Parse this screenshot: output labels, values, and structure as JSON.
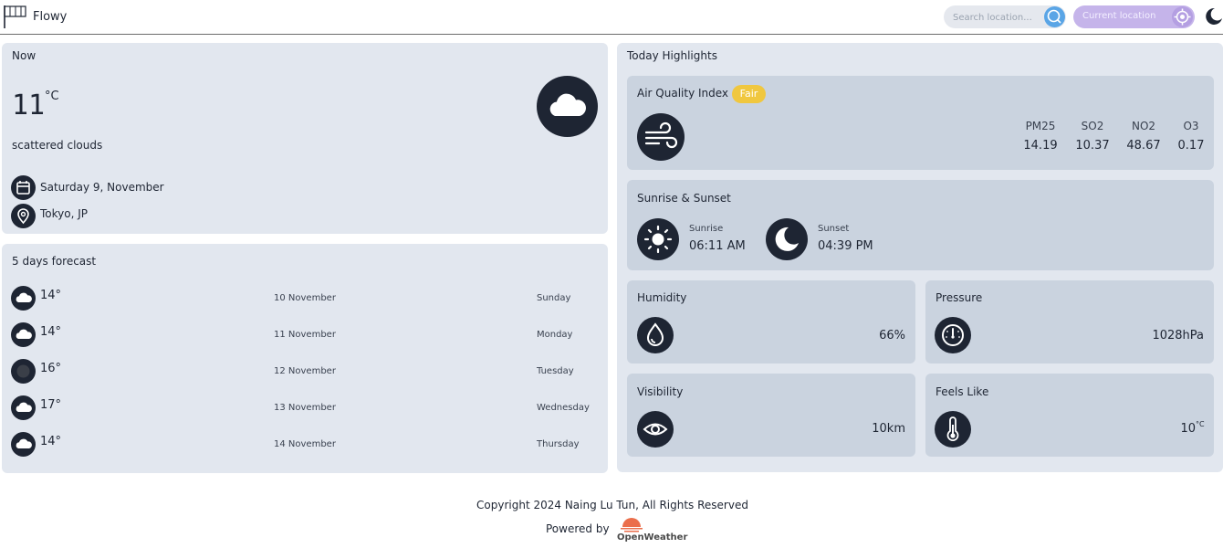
{
  "header": {
    "brand": "Flowy",
    "search_placeholder": "Search location...",
    "current_location_label": "Current location"
  },
  "now": {
    "title": "Now",
    "temperature": "11",
    "unit": "°C",
    "description": "scattered clouds",
    "date": "Saturday 9, November",
    "location": "Tokyo, JP"
  },
  "forecast": {
    "title": "5 days forecast",
    "days": [
      {
        "temp": "14°",
        "date": "10 November",
        "day": "Sunday",
        "icon": "cloud-icon"
      },
      {
        "temp": "14°",
        "date": "11 November",
        "day": "Monday",
        "icon": "cloud-icon"
      },
      {
        "temp": "16°",
        "date": "12 November",
        "day": "Tuesday",
        "icon": "overcast-icon"
      },
      {
        "temp": "17°",
        "date": "13 November",
        "day": "Wednesday",
        "icon": "cloud-icon"
      },
      {
        "temp": "14°",
        "date": "14 November",
        "day": "Thursday",
        "icon": "cloud-icon"
      }
    ]
  },
  "highlights": {
    "title": "Today Highlights",
    "air_quality": {
      "title": "Air Quality Index",
      "badge": "Fair",
      "items": [
        {
          "label": "PM25",
          "value": "14.19"
        },
        {
          "label": "SO2",
          "value": "10.37"
        },
        {
          "label": "NO2",
          "value": "48.67"
        },
        {
          "label": "O3",
          "value": "0.17"
        }
      ]
    },
    "sun": {
      "title": "Sunrise & Sunset",
      "sunrise_label": "Sunrise",
      "sunrise": "06:11 AM",
      "sunset_label": "Sunset",
      "sunset": "04:39 PM"
    },
    "humidity": {
      "title": "Humidity",
      "value": "66%"
    },
    "pressure": {
      "title": "Pressure",
      "value": "1028hPa"
    },
    "visibility": {
      "title": "Visibility",
      "value": "10km"
    },
    "feels_like": {
      "title": "Feels Like",
      "value": "10",
      "unit": "°C"
    }
  },
  "footer": {
    "copyright": "Copyright 2024 Naing Lu Tun, All Rights Reserved",
    "powered_by": "Powered by",
    "provider": "OpenWeather"
  },
  "colors": {
    "card": "#e2e7ef",
    "sub_card": "#cad3df",
    "dark": "#1e2533",
    "badge_fair": "#f0c73f",
    "search_button": "#5aa5e6",
    "location_button": "#c5b4ea"
  }
}
